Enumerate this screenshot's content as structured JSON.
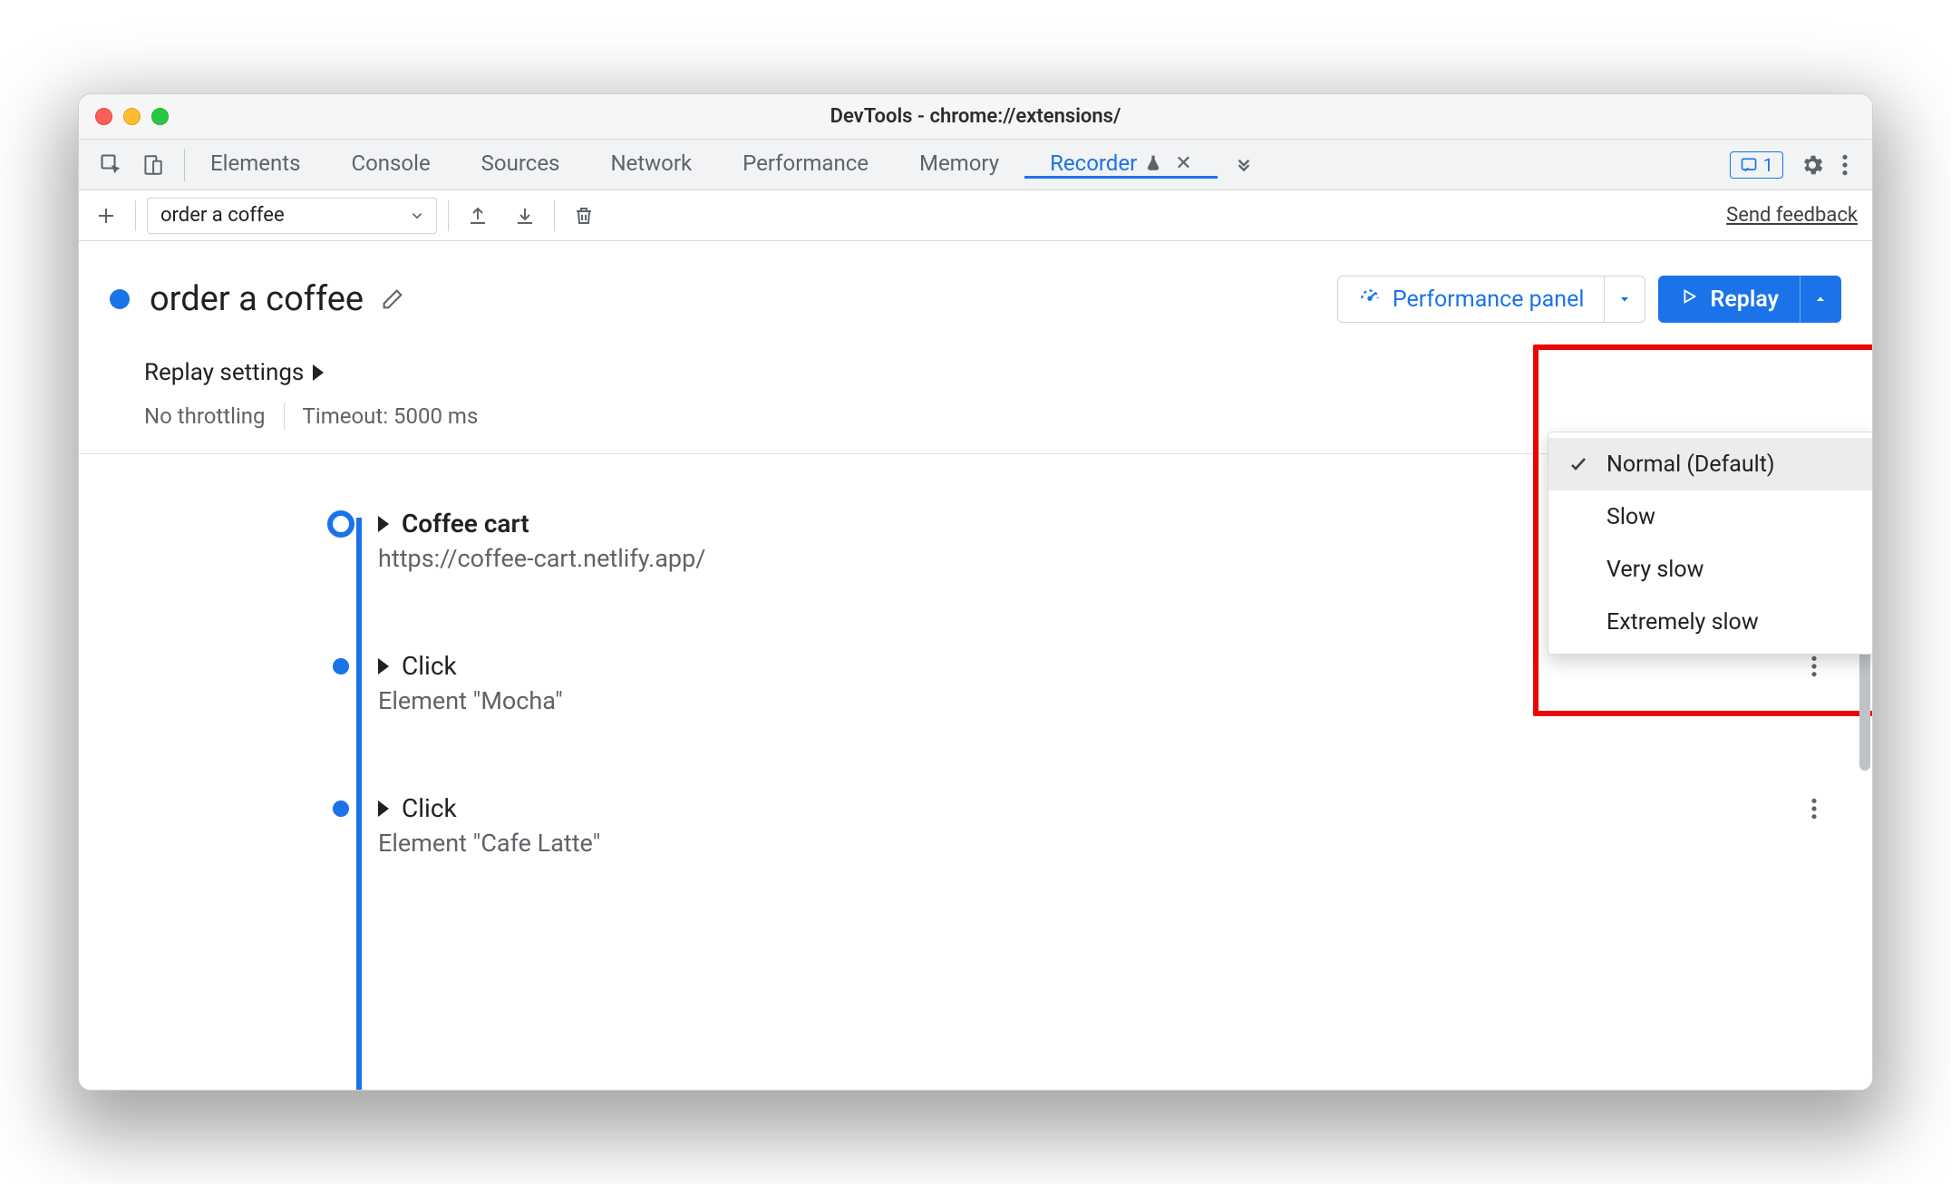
{
  "window": {
    "title": "DevTools - chrome://extensions/"
  },
  "tabs": {
    "items": [
      "Elements",
      "Console",
      "Sources",
      "Network",
      "Performance",
      "Memory",
      "Recorder"
    ],
    "active_index": 6,
    "issue_count": "1"
  },
  "toolbar": {
    "recording_name": "order a coffee",
    "feedback": "Send feedback"
  },
  "header": {
    "title": "order a coffee",
    "perf_label": "Performance panel",
    "replay_label": "Replay"
  },
  "replay_menu": {
    "items": [
      "Normal (Default)",
      "Slow",
      "Very slow",
      "Extremely slow"
    ],
    "selected_index": 0
  },
  "settings": {
    "title": "Replay settings",
    "throttling": "No throttling",
    "timeout": "Timeout: 5000 ms"
  },
  "steps": [
    {
      "title": "Coffee cart",
      "subtitle": "https://coffee-cart.netlify.app/",
      "bold": true,
      "hollow": true
    },
    {
      "title": "Click",
      "subtitle": "Element \"Mocha\"",
      "bold": false,
      "hollow": false
    },
    {
      "title": "Click",
      "subtitle": "Element \"Cafe Latte\"",
      "bold": false,
      "hollow": false
    }
  ]
}
